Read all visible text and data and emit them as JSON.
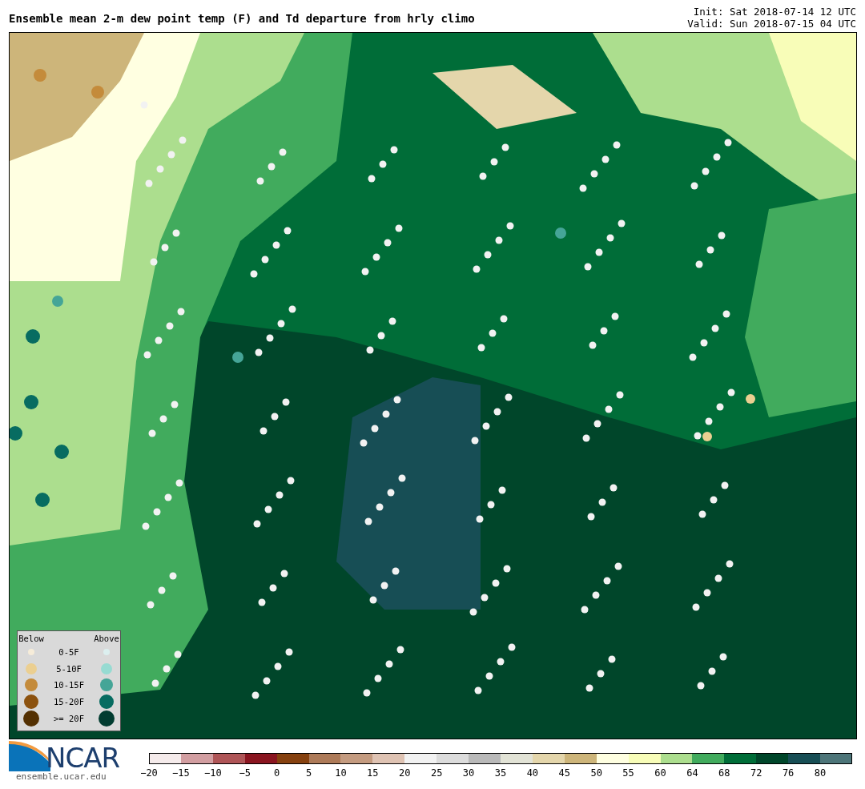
{
  "header": {
    "title": "Ensemble mean 2-m dew point temp (F) and Td departure from hrly climo",
    "init": "Init: Sat 2018-07-14 12 UTC",
    "valid": "Valid: Sun 2018-07-15 04 UTC"
  },
  "legend": {
    "below_label": "Below",
    "above_label": "Above",
    "rows": [
      {
        "label": "0-5F",
        "below": {
          "color": "#f6ecd9"
        },
        "above": {
          "color": "#dcefef"
        }
      },
      {
        "label": "5-10F",
        "below": {
          "color": "#ebcf91"
        },
        "above": {
          "color": "#97dbd2"
        }
      },
      {
        "label": "10-15F",
        "below": {
          "color": "#c48b3b"
        },
        "above": {
          "color": "#45a597"
        }
      },
      {
        "label": "15-20F",
        "below": {
          "color": "#8c520f"
        },
        "above": {
          "color": "#076c61"
        }
      },
      {
        "label": ">= 20F",
        "below": {
          "color": "#533002"
        },
        "above": {
          "color": "#013c30"
        }
      }
    ]
  },
  "logo": {
    "name": "NCAR",
    "url": "ensemble.ucar.edu"
  },
  "colorbar": [
    {
      "label": "−20",
      "color": "#f5ebeb"
    },
    {
      "label": "−15",
      "color": "#d29ea1"
    },
    {
      "label": "−10",
      "color": "#af5557"
    },
    {
      "label": "−5",
      "color": "#8a1520"
    },
    {
      "label": "0",
      "color": "#86410f"
    },
    {
      "label": "5",
      "color": "#ad7a58"
    },
    {
      "label": "10",
      "color": "#c49b80"
    },
    {
      "label": "15",
      "color": "#dfc3b3"
    },
    {
      "label": "20",
      "color": "#f2f2f2"
    },
    {
      "label": "25",
      "color": "#dcdcdc"
    },
    {
      "label": "30",
      "color": "#b9b9b9"
    },
    {
      "label": "35",
      "color": "#e2e3d6"
    },
    {
      "label": "40",
      "color": "#e4d6ab"
    },
    {
      "label": "45",
      "color": "#cdb57a"
    },
    {
      "label": "50",
      "color": "#ffffe1"
    },
    {
      "label": "55",
      "color": "#f8fdb8"
    },
    {
      "label": "60",
      "color": "#acde8e"
    },
    {
      "label": "64",
      "color": "#41ab5d"
    },
    {
      "label": "68",
      "color": "#006d38"
    },
    {
      "label": "72",
      "color": "#00462a"
    },
    {
      "label": "76",
      "color": "#174e55"
    },
    {
      "label": "80",
      "color": "#4d7579"
    }
  ]
}
